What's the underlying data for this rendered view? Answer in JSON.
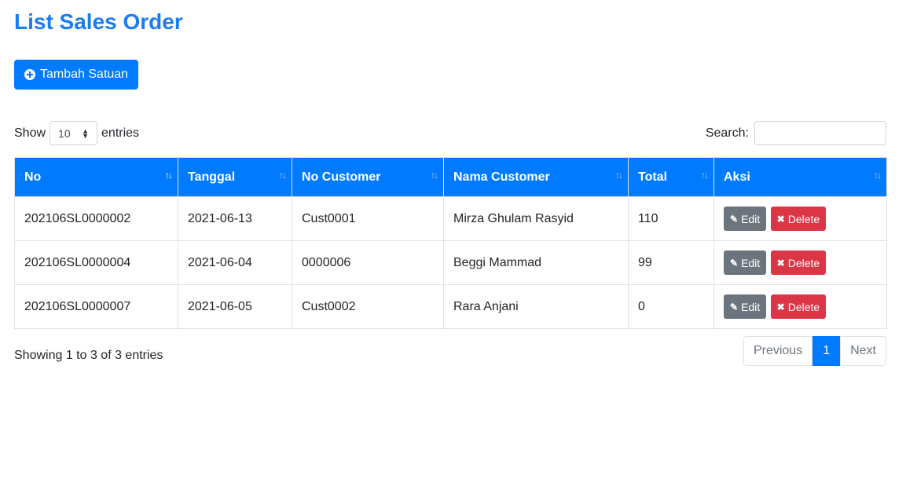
{
  "page": {
    "title": "List Sales Order"
  },
  "toolbar": {
    "add_label": "Tambah Satuan",
    "add_icon": "plus-circle-icon"
  },
  "length_menu": {
    "prefix": "Show",
    "value": "10",
    "suffix": "entries"
  },
  "search": {
    "label": "Search:",
    "value": "",
    "placeholder": ""
  },
  "table": {
    "columns": [
      "No",
      "Tanggal",
      "No Customer",
      "Nama Customer",
      "Total",
      "Aksi"
    ],
    "rows": [
      {
        "no": "202106SL0000002",
        "tanggal": "2021-06-13",
        "no_customer": "Cust0001",
        "nama_customer": "Mirza Ghulam Rasyid",
        "total": "110"
      },
      {
        "no": "202106SL0000004",
        "tanggal": "2021-06-04",
        "no_customer": "0000006",
        "nama_customer": "Beggi Mammad",
        "total": "99"
      },
      {
        "no": "202106SL0000007",
        "tanggal": "2021-06-05",
        "no_customer": "Cust0002",
        "nama_customer": "Rara Anjani",
        "total": "0"
      }
    ],
    "actions": {
      "edit": "Edit",
      "delete": "Delete"
    }
  },
  "footer": {
    "info": "Showing 1 to 3 of 3 entries",
    "previous": "Previous",
    "current_page": "1",
    "next": "Next"
  },
  "colors": {
    "primary": "#007bff",
    "title": "#1a7cf5",
    "edit": "#6c757d",
    "delete": "#dc3545"
  }
}
